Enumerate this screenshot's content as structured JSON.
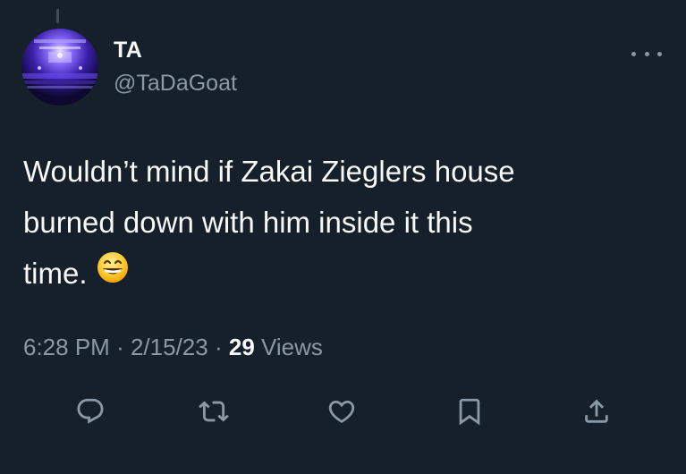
{
  "tweet": {
    "author": {
      "display_name": "TA",
      "handle": "@TaDaGoat"
    },
    "text_lines": [
      "Wouldn’t mind if Zakai Zieglers house",
      "burned down with him inside it this",
      "time."
    ],
    "emoji": "grinning-face-with-smiling-eyes-icon",
    "meta": {
      "time": "6:28 PM",
      "separator": "·",
      "date": "2/15/23",
      "views_count": "29",
      "views_label": "Views"
    }
  },
  "actions": [
    {
      "name": "reply",
      "icon": "reply-icon"
    },
    {
      "name": "retweet",
      "icon": "retweet-icon"
    },
    {
      "name": "like",
      "icon": "heart-icon"
    },
    {
      "name": "bookmark",
      "icon": "bookmark-icon"
    },
    {
      "name": "share",
      "icon": "share-icon"
    }
  ],
  "colors": {
    "background": "#15202b",
    "primary_text": "#f7f9f9",
    "secondary_text": "#8b98a5"
  }
}
